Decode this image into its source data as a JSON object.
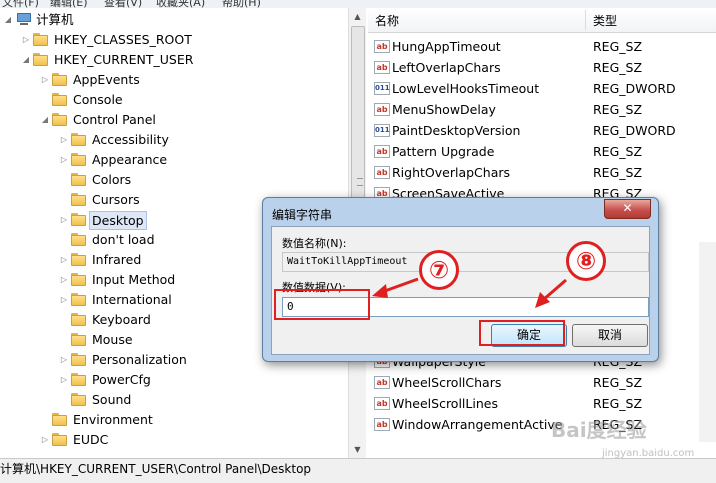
{
  "menubar": {
    "items": [
      "文件(F)",
      "编辑(E)",
      "查看(V)",
      "收藏夹(A)",
      "帮助(H)"
    ]
  },
  "tree": {
    "root": "计算机",
    "items": [
      {
        "label": "HKEY_CLASSES_ROOT",
        "arrow": "▷"
      },
      {
        "label": "HKEY_CURRENT_USER",
        "arrow": "◢"
      },
      {
        "label": "AppEvents",
        "arrow": "▷"
      },
      {
        "label": "Console",
        "arrow": ""
      },
      {
        "label": "Control Panel",
        "arrow": "◢"
      },
      {
        "label": "Accessibility",
        "arrow": "▷"
      },
      {
        "label": "Appearance",
        "arrow": "▷"
      },
      {
        "label": "Colors",
        "arrow": ""
      },
      {
        "label": "Cursors",
        "arrow": ""
      },
      {
        "label": "Desktop",
        "arrow": "▷"
      },
      {
        "label": "don't load",
        "arrow": ""
      },
      {
        "label": "Infrared",
        "arrow": "▷"
      },
      {
        "label": "Input Method",
        "arrow": "▷"
      },
      {
        "label": "International",
        "arrow": "▷"
      },
      {
        "label": "Keyboard",
        "arrow": ""
      },
      {
        "label": "Mouse",
        "arrow": ""
      },
      {
        "label": "Personalization",
        "arrow": "▷"
      },
      {
        "label": "PowerCfg",
        "arrow": "▷"
      },
      {
        "label": "Sound",
        "arrow": ""
      },
      {
        "label": "Environment",
        "arrow": ""
      },
      {
        "label": "EUDC",
        "arrow": "▷"
      }
    ]
  },
  "list": {
    "col_name": "名称",
    "col_type": "类型",
    "rows": [
      {
        "name": "HungAppTimeout",
        "type": "REG_SZ",
        "icon": "ab"
      },
      {
        "name": "LeftOverlapChars",
        "type": "REG_SZ",
        "icon": "ab"
      },
      {
        "name": "LowLevelHooksTimeout",
        "type": "REG_DWORD",
        "icon": "011"
      },
      {
        "name": "MenuShowDelay",
        "type": "REG_SZ",
        "icon": "ab"
      },
      {
        "name": "PaintDesktopVersion",
        "type": "REG_DWORD",
        "icon": "011"
      },
      {
        "name": "Pattern Upgrade",
        "type": "REG_SZ",
        "icon": "ab"
      },
      {
        "name": "RightOverlapChars",
        "type": "REG_SZ",
        "icon": "ab"
      },
      {
        "name": "ScreenSaveActive",
        "type": "REG_SZ",
        "icon": "ab"
      },
      {
        "name": "WallpaperStyle",
        "type": "REG_SZ",
        "icon": "ab"
      },
      {
        "name": "WheelScrollChars",
        "type": "REG_SZ",
        "icon": "ab"
      },
      {
        "name": "WheelScrollLines",
        "type": "REG_SZ",
        "icon": "ab"
      },
      {
        "name": "WindowArrangementActive",
        "type": "REG_SZ",
        "icon": "ab"
      }
    ]
  },
  "status": "计算机\\HKEY_CURRENT_USER\\Control Panel\\Desktop",
  "dialog": {
    "title": "编辑字符串",
    "close": "✕",
    "name_label": "数值名称(N):",
    "name_value": "WaitToKillAppTimeout",
    "data_label": "数值数据(V):",
    "data_value": "0",
    "ok": "确定",
    "cancel": "取消"
  },
  "annotations": {
    "step7": "⑦",
    "step8": "⑧",
    "color": "#e02020"
  },
  "watermark": {
    "brand": "Bai度经验",
    "url": "jingyan.baidu.com"
  }
}
